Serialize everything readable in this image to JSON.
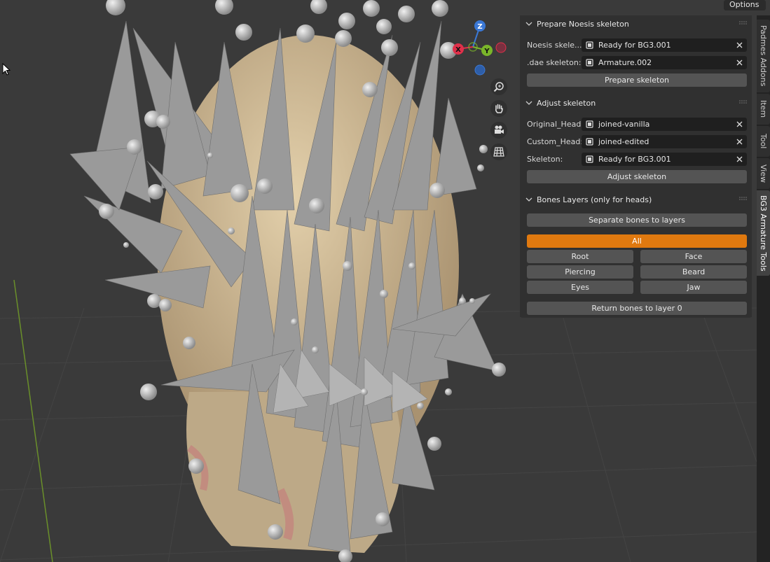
{
  "header": {
    "options_label": "Options"
  },
  "gizmo": {
    "z_label": "Z",
    "y_label": "Y",
    "x_label": "X"
  },
  "nav_icons": [
    "zoom-icon",
    "hand-pan-icon",
    "camera-icon",
    "grid-ortho-icon"
  ],
  "panel": {
    "prepare": {
      "title": "Prepare Noesis skeleton",
      "noesis_label": "Noesis skele...",
      "noesis_value": "Ready for BG3.001",
      "dae_label": ".dae skeleton:",
      "dae_value": "Armature.002",
      "button": "Prepare skeleton"
    },
    "adjust": {
      "title": "Adjust skeleton",
      "original_label": "Original_Head:",
      "original_value": "joined-vanilla",
      "custom_label": "Custom_Head:",
      "custom_value": "joined-edited",
      "skeleton_label": "Skeleton:",
      "skeleton_value": "Ready for BG3.001",
      "button": "Adjust skeleton"
    },
    "layers": {
      "title": "Bones Layers (only for heads)",
      "separate_button": "Separate bones to layers",
      "all_button": "All",
      "root_button": "Root",
      "face_button": "Face",
      "piercing_button": "Piercing",
      "beard_button": "Beard",
      "eyes_button": "Eyes",
      "jaw_button": "Jaw",
      "return_button": "Return bones to layer 0"
    }
  },
  "tabs": [
    "Padmes Addons",
    "Item",
    "Tool",
    "View",
    "BG3 Armature Tools"
  ],
  "active_tab": "BG3 Armature Tools",
  "colors": {
    "accent": "#e0790f",
    "x_axis": "#e0304a",
    "y_axis": "#7ab52a",
    "z_axis": "#3a78d6"
  }
}
